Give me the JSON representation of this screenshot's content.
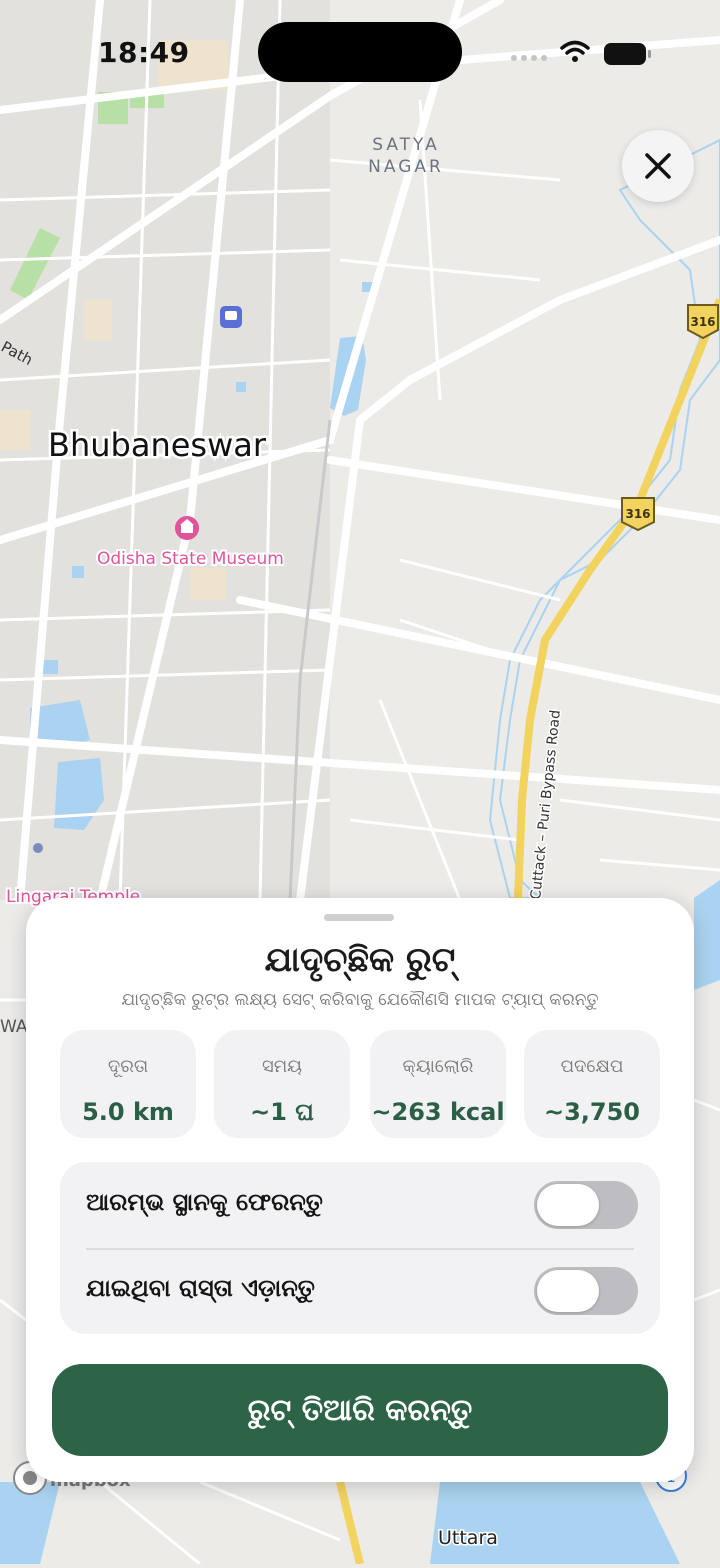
{
  "status_bar": {
    "time": "18:49"
  },
  "map": {
    "labels": {
      "city": "Bhubaneswar",
      "satya_line1": "SATYA",
      "satya_line2": "NAGAR",
      "museum": "Odisha State Museum",
      "temple": "Lingaraj Temple",
      "road": "Cuttack – Puri Bypass Road",
      "path": "Path",
      "uttara": "Uttara",
      "highway_1": "316",
      "highway_2": "316",
      "edge_w": "WA",
      "attribution_badge": "1",
      "mapbox": "mapbox"
    },
    "colors": {
      "water": "#a9d3f0",
      "park": "#b7e0a6",
      "highway": "#f2d35e",
      "poi": "#e0559a"
    }
  },
  "close_button": {
    "icon": "close-icon"
  },
  "sheet": {
    "title": "ଯାଦୃଚ୍ଛିକ ରୁଟ୍",
    "subtitle": "ଯାଦୃଚ୍ଛିକ ରୁଟ୍‌ର ଲକ୍ଷ୍ୟ ସେଟ୍ କରିବାକୁ ଯେକୌଣସି ମାପକ ଟ୍ୟାପ୍ କରନ୍ତୁ",
    "stats": [
      {
        "label": "ଦୂରତା",
        "value": "5.0 km"
      },
      {
        "label": "ସମୟ",
        "value": "~1 ଘ"
      },
      {
        "label": "କ୍ୟାଲୋରି",
        "value": "~263 kcal"
      },
      {
        "label": "ପଦକ୍ଷେପ",
        "value": "~3,750"
      }
    ],
    "options": [
      {
        "label": "ଆରମ୍ଭ ସ୍ଥାନକୁ ଫେରନ୍ତୁ",
        "enabled": false
      },
      {
        "label": "ଯାଇଥିବା ରାସ୍ତା ଏଡ଼ାନ୍ତୁ",
        "enabled": false
      }
    ],
    "cta_label": "ରୁଟ୍ ତିଆରି କରନ୍ତୁ",
    "accent": "#2d6448"
  }
}
